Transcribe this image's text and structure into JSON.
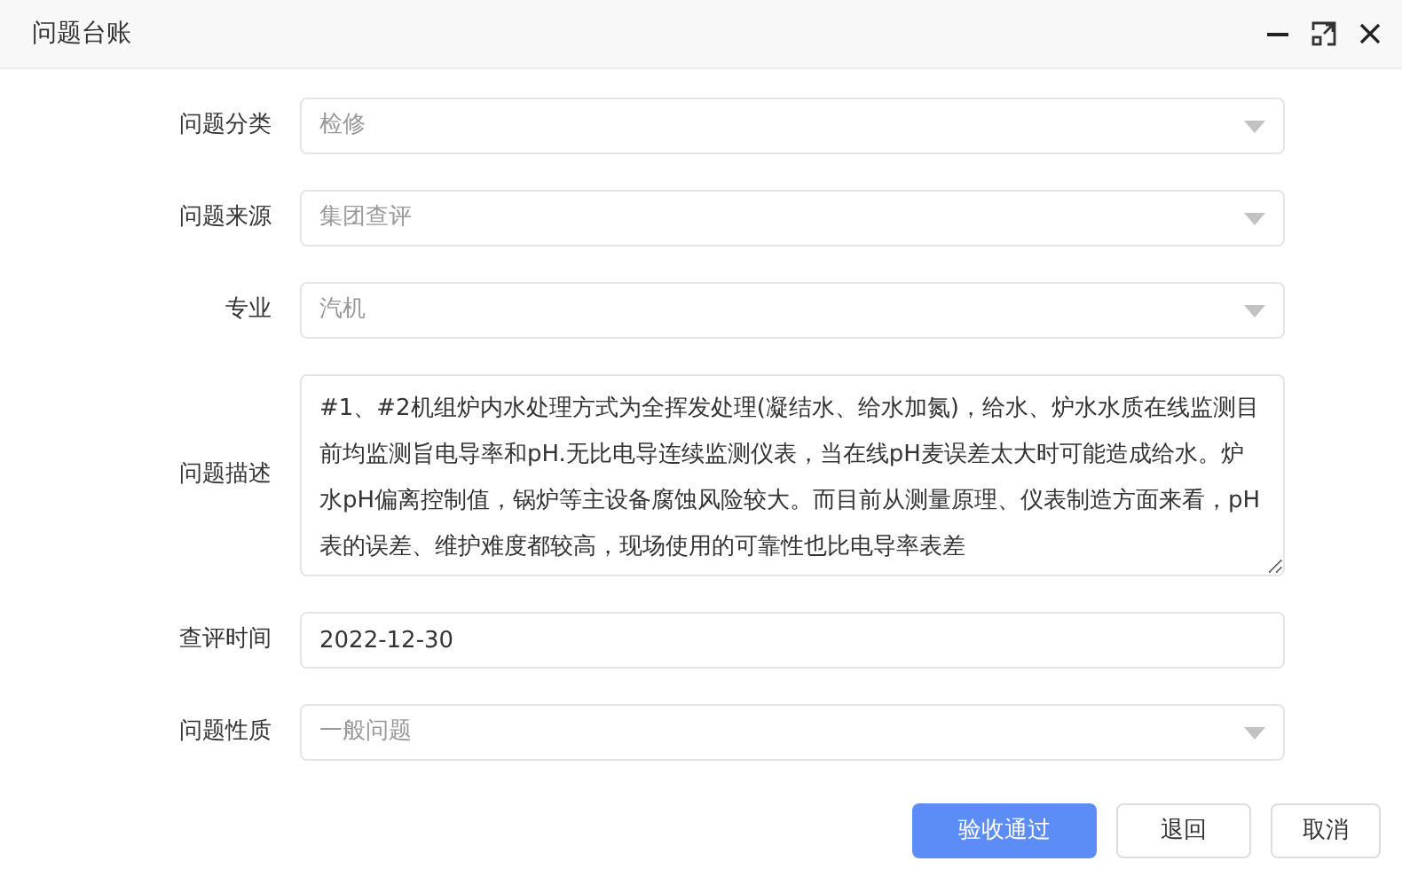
{
  "window": {
    "title": "问题台账"
  },
  "fields": [
    {
      "kind": "select",
      "label": "问题分类",
      "value": "检修"
    },
    {
      "kind": "select",
      "label": "问题来源",
      "value": "集团查评"
    },
    {
      "kind": "select",
      "label": "专业",
      "value": "汽机"
    },
    {
      "kind": "textarea",
      "label": "问题描述",
      "value": "#1、#2机组炉内水处理方式为全挥发处理(凝结水、给水加氮)，给水、炉水水质在线监测目前均监测旨电导率和pH.无比电导连续监测仪表，当在线pH麦误差太大时可能造成给水。炉水pH偏离控制值，锅炉等主设备腐蚀风险较大。而目前从测量原理、仪表制造方面来看，pH表的误差、维护难度都较高，现场使用的可靠性也比电导率表差"
    },
    {
      "kind": "text",
      "label": "查评时间",
      "value": "2022-12-30"
    },
    {
      "kind": "select",
      "label": "问题性质",
      "value": "一般问题"
    }
  ],
  "buttons": [
    {
      "kind": "primary",
      "label": "验收通过"
    },
    {
      "kind": "default",
      "label": "退回"
    },
    {
      "kind": "default",
      "label": "取消"
    }
  ]
}
